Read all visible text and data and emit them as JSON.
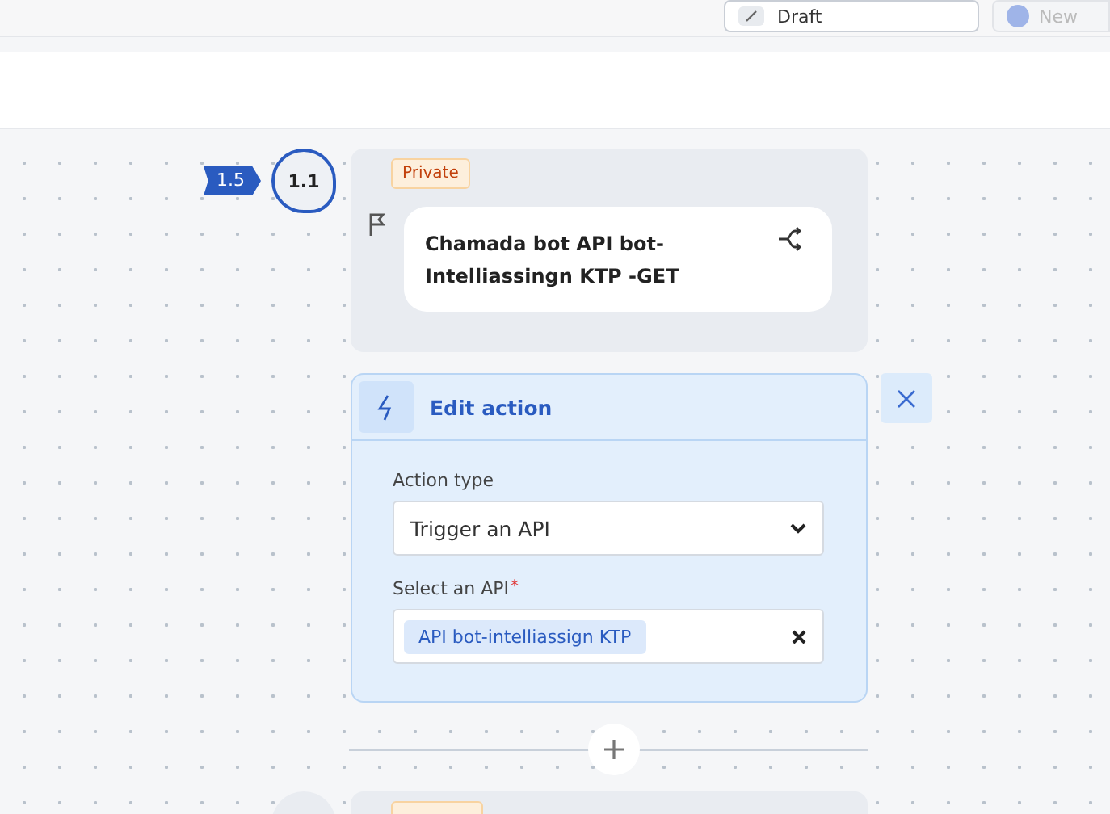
{
  "toolbar": {
    "status_select": {
      "value": "Draft"
    },
    "new_button": {
      "label": "New",
      "disabled": true
    }
  },
  "step": {
    "badge": "1.5",
    "number": "1.1",
    "tag": "Private",
    "title": "Chamada bot API bot-Intelliassingn KTP -GET"
  },
  "edit_action": {
    "title": "Edit action",
    "fields": [
      {
        "kind": "select",
        "label": "Action type",
        "value": "Trigger an API"
      },
      {
        "kind": "tags",
        "label": "Select an API",
        "required_mark": "*",
        "tags": [
          "API bot-intelliassign KTP"
        ]
      }
    ]
  }
}
